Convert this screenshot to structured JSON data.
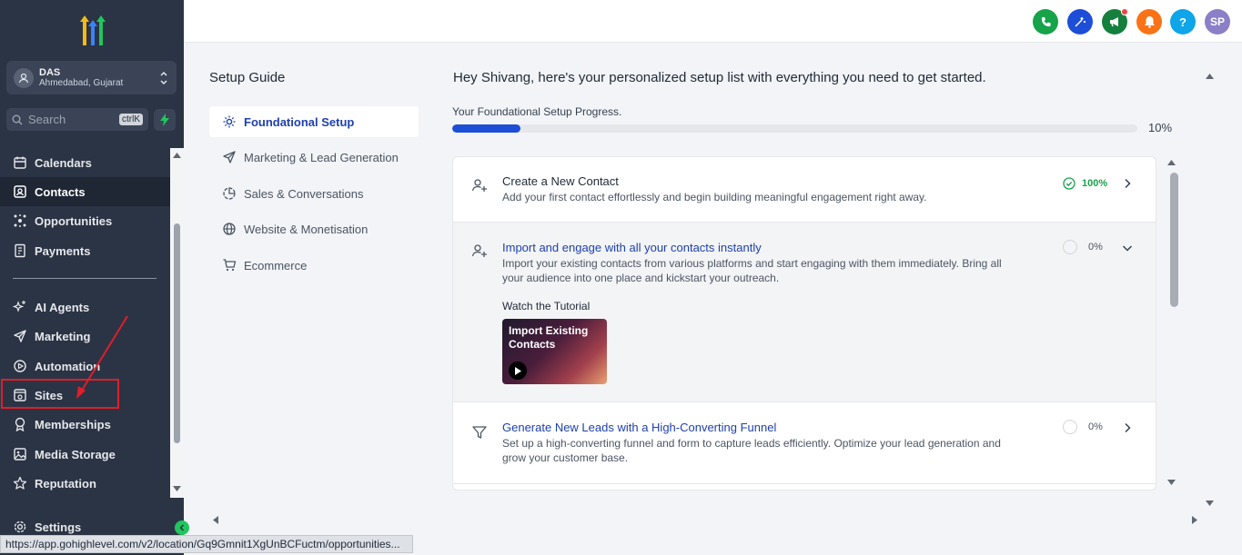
{
  "sidebar": {
    "account": {
      "name": "DAS",
      "location": "Ahmedabad, Gujarat"
    },
    "search": {
      "placeholder": "Search",
      "shortcut": "ctrlK"
    },
    "items": [
      {
        "label": "Calendars",
        "icon": "calendar-icon"
      },
      {
        "label": "Contacts",
        "icon": "contacts-icon",
        "active": true
      },
      {
        "label": "Opportunities",
        "icon": "opportunities-icon"
      },
      {
        "label": "Payments",
        "icon": "payments-icon"
      },
      {
        "label": "AI Agents",
        "icon": "sparkle-icon"
      },
      {
        "label": "Marketing",
        "icon": "send-icon"
      },
      {
        "label": "Automation",
        "icon": "play-circle-icon"
      },
      {
        "label": "Sites",
        "icon": "sites-icon"
      },
      {
        "label": "Memberships",
        "icon": "badge-icon"
      },
      {
        "label": "Media Storage",
        "icon": "image-icon"
      },
      {
        "label": "Reputation",
        "icon": "star-icon"
      },
      {
        "label": "Settings",
        "icon": "gear-icon"
      }
    ]
  },
  "status_url": "https://app.gohighlevel.com/v2/location/Gq9Gmnit1XgUnBCFuctm/opportunities...",
  "topbar": {
    "avatar_initials": "SP",
    "help": "?"
  },
  "setup_guide": {
    "title": "Setup Guide",
    "items": [
      {
        "label": "Foundational Setup",
        "active": true
      },
      {
        "label": "Marketing & Lead Generation"
      },
      {
        "label": "Sales & Conversations"
      },
      {
        "label": "Website & Monetisation"
      },
      {
        "label": "Ecommerce"
      }
    ]
  },
  "main": {
    "greeting": "Hey Shivang, here's your personalized setup list with everything you need to get started.",
    "progress_label": "Your Foundational Setup Progress.",
    "progress_value": 0.1,
    "progress_text": "10%",
    "tasks": [
      {
        "title": "Create a New Contact",
        "description": "Add your first contact effortlessly and begin building meaningful engagement right away.",
        "percent": "100%",
        "status": "complete"
      },
      {
        "title": "Import and engage with all your contacts instantly",
        "description": "Import your existing contacts from various platforms and start engaging with them immediately. Bring all your audience into one place and kickstart your outreach.",
        "percent": "0%",
        "expanded": true,
        "tutorial_label": "Watch the Tutorial",
        "tutorial_thumb": "Import Existing Contacts"
      },
      {
        "title": "Generate New Leads with a High-Converting Funnel",
        "description": "Set up a high-converting funnel and form to capture leads efficiently. Optimize your lead generation and grow your customer base.",
        "percent": "0%"
      }
    ]
  },
  "colors": {
    "accent": "#1d4ed8",
    "sidebar": "#2b3444",
    "success": "#16a34a",
    "highlight": "#e11d2a"
  }
}
